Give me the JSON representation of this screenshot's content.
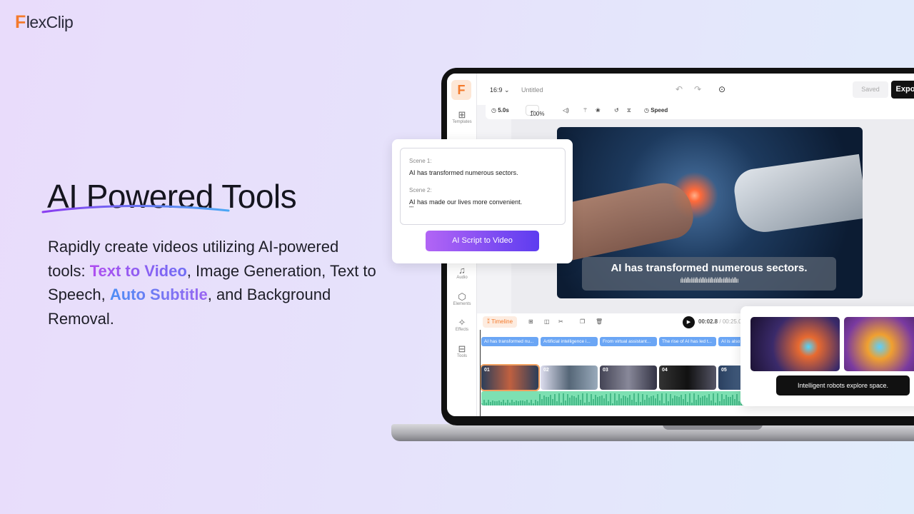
{
  "brand": {
    "logo_letter": "F",
    "logo_rest": "lexClip",
    "accent": "#f47a2c"
  },
  "hero": {
    "title": "AI Powered Tools",
    "desc_1": "Rapidly create videos utilizing AI-powered tools: ",
    "hl_1": "Text to Video",
    "desc_2": ", Image Generation, Text to Speech, ",
    "hl_2": "Auto Subtitle",
    "desc_3": ", and Background Removal."
  },
  "editor": {
    "app_logo": "F",
    "sidebar": [
      "Templates",
      "Audio",
      "Elements",
      "Effects",
      "Tools"
    ],
    "aspect": "16:9",
    "title": "Untitled",
    "saved": "Saved",
    "export": "Export",
    "toolbar": {
      "duration": "5.0s",
      "zoom": "100%",
      "speed": "Speed"
    },
    "caption": "AI has transformed numerous sectors.",
    "timeline": {
      "label": "Timeline",
      "current": "00:02.8",
      "total": "/ 00:25.0",
      "subtitles": [
        "AI has transformed nu...",
        "Artificial intelligence i...",
        "From virtual assistant...",
        "The rise of AI has led t...",
        "AI is also"
      ],
      "clips": [
        "01",
        "02",
        "03",
        "04",
        "05"
      ]
    }
  },
  "script_card": {
    "scene1_label": "Scene 1:",
    "scene1_text": "AI has transformed numerous sectors.",
    "scene2_label": "Scene 2:",
    "scene2_text": "AI has made our lives more convenient.",
    "more": "•••",
    "button": "AI Script to Video"
  },
  "image_gen": {
    "prompt": "Intelligent robots explore space."
  }
}
